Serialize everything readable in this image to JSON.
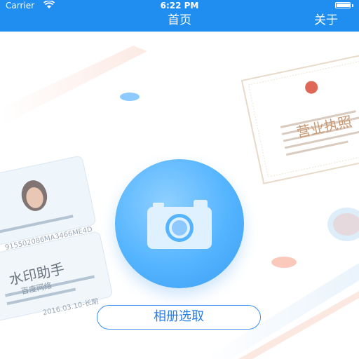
{
  "status_bar": {
    "carrier": "Carrier",
    "time": "6:22 PM"
  },
  "nav": {
    "title": "首页",
    "right_button": "关于"
  },
  "main": {
    "album_button_label": "相册选取",
    "camera_icon": "camera-icon"
  },
  "background": {
    "license_title": "营业执照",
    "id_card_text": "水印助手",
    "id_card_subtext": "百度网络",
    "id_card_number": "915502086MA3466ME4D",
    "id_card_date": "2016.03.10-长期"
  },
  "colors": {
    "nav": "#1f8ef0",
    "accent": "#3a8ff0",
    "camera": "#54b4ff"
  }
}
